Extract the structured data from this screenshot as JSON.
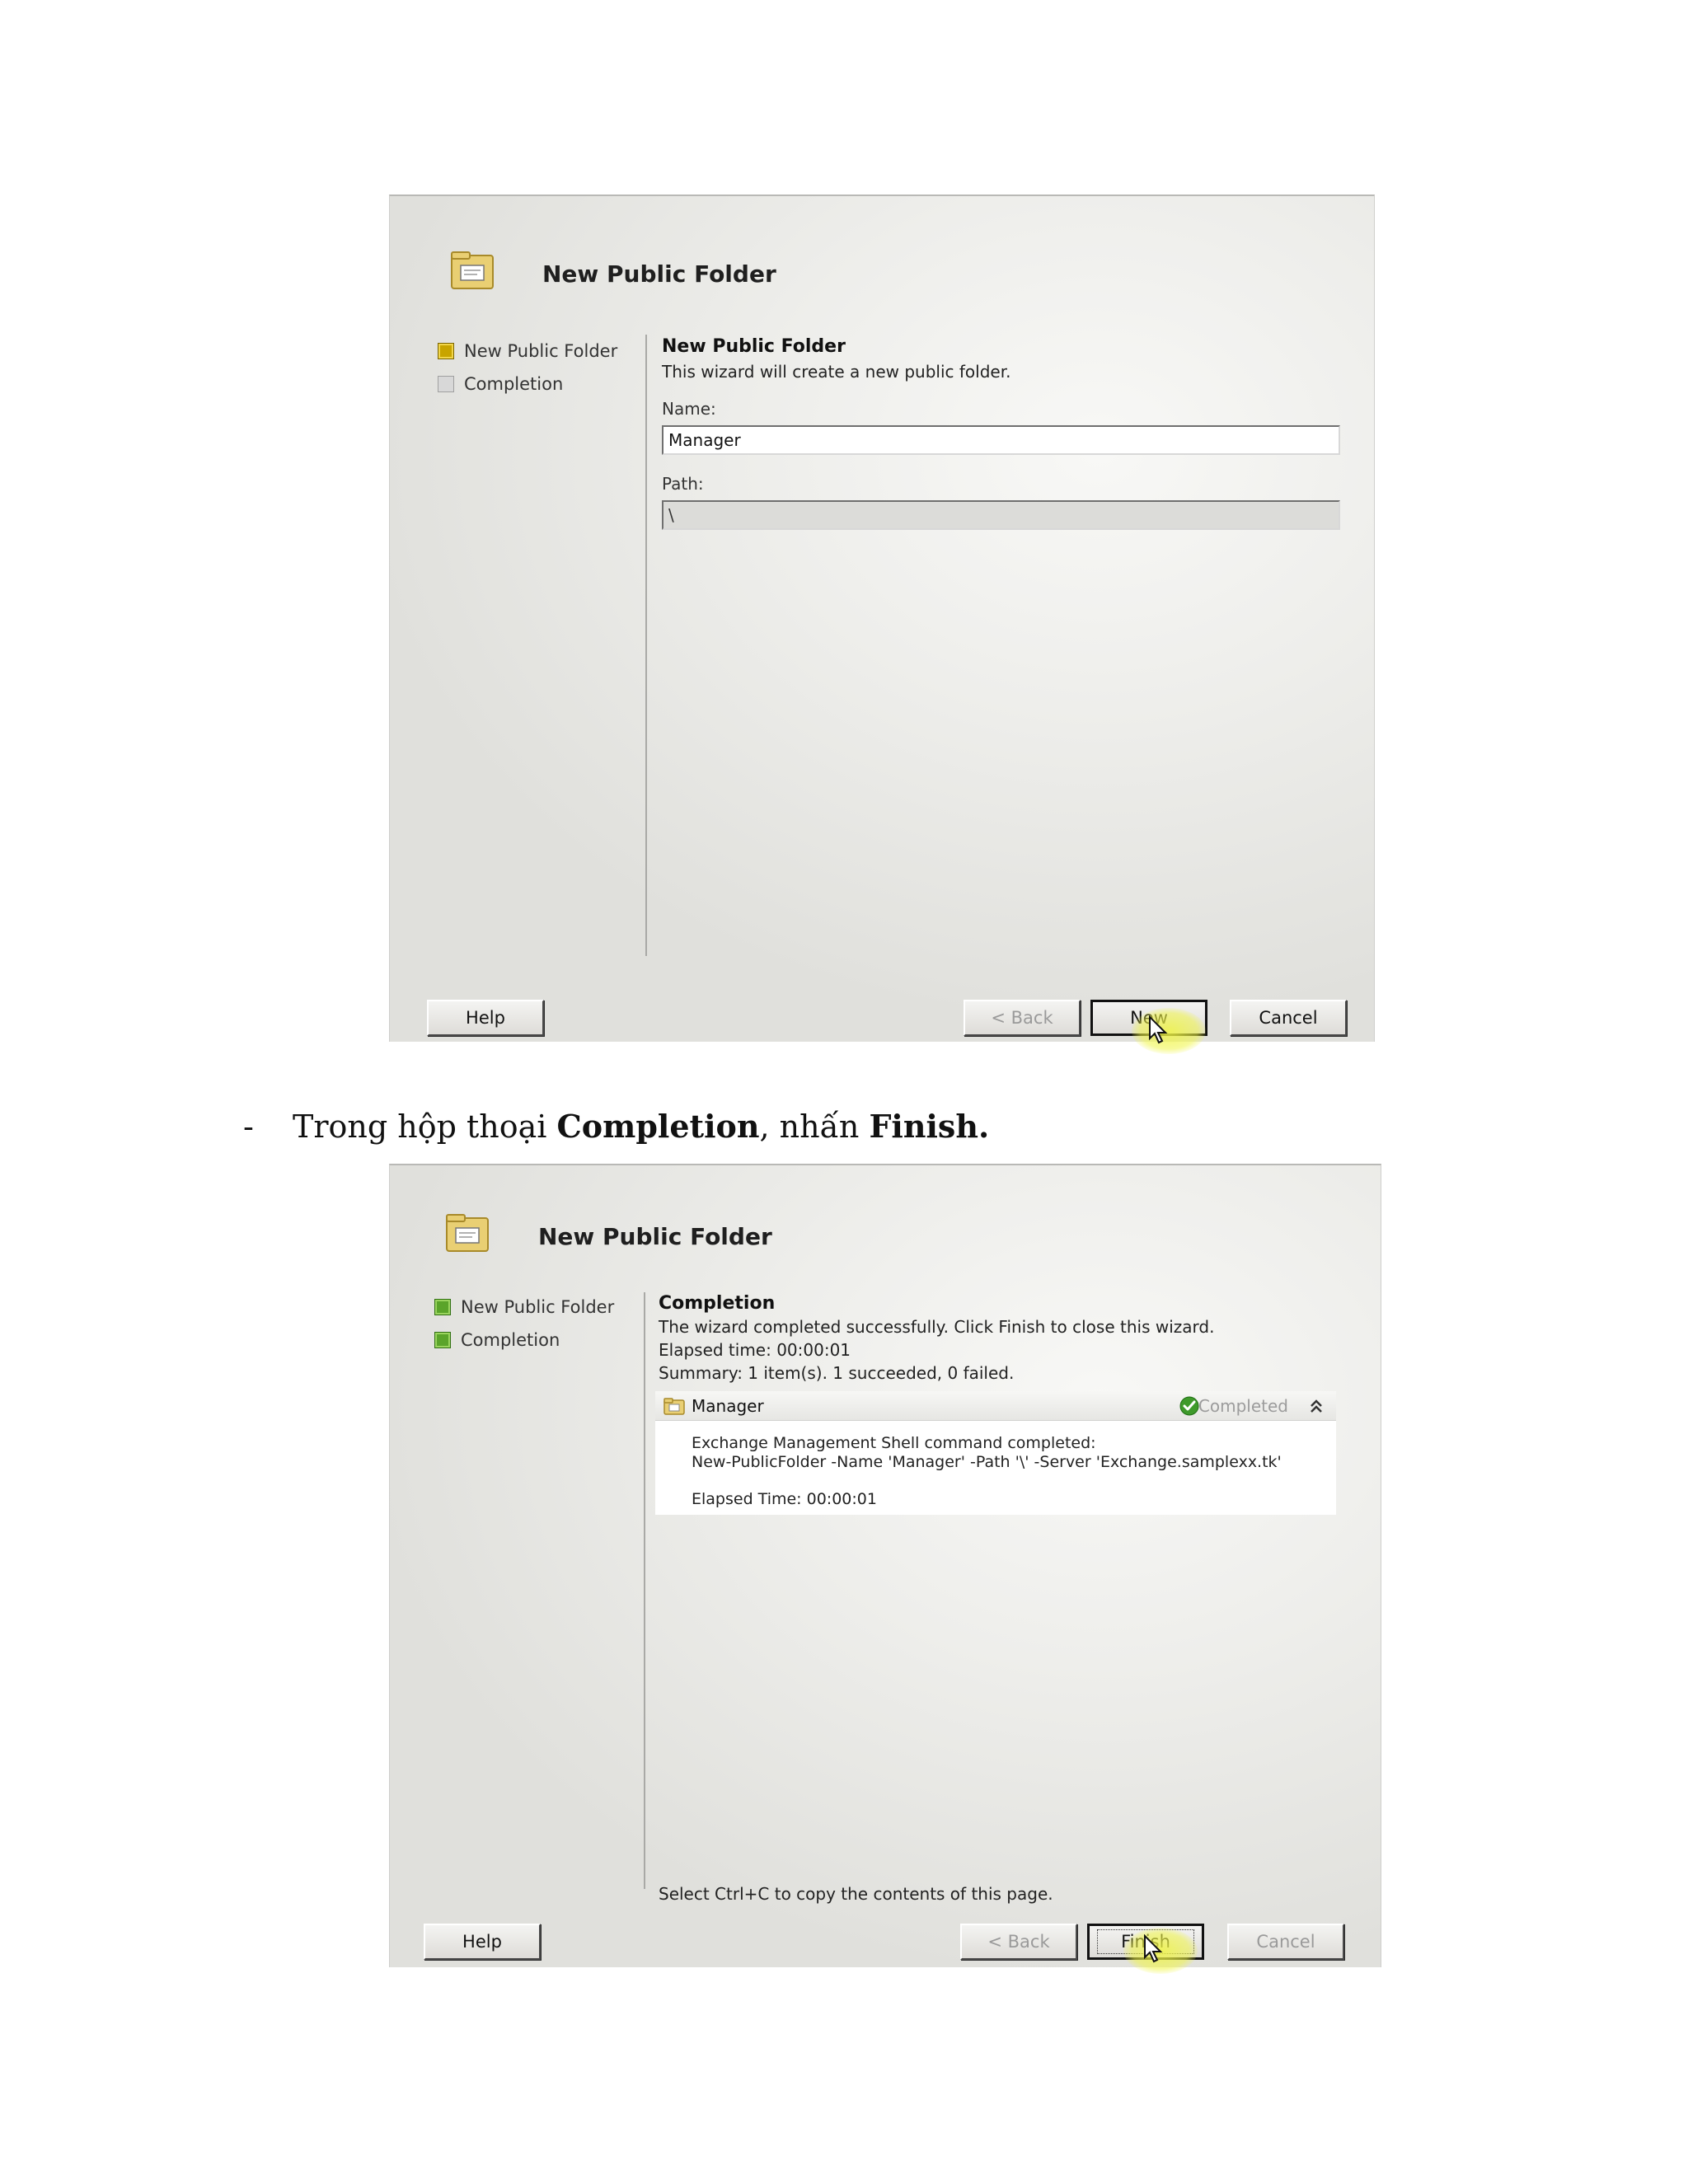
{
  "wizard1": {
    "title": "New Public Folder",
    "steps": [
      {
        "label": "New Public Folder"
      },
      {
        "label": "Completion"
      }
    ],
    "section_title": "New Public Folder",
    "description": "This wizard will create a new public folder.",
    "name_label": "Name:",
    "name_value": "Manager",
    "path_label": "Path:",
    "path_value": "\\",
    "buttons": {
      "help": "Help",
      "back": "< Back",
      "new": "New",
      "cancel": "Cancel"
    }
  },
  "instruction": {
    "dash": "-",
    "prefix": "Trong hộp thoại ",
    "bold1": "Completion",
    "middle": ", nhấn ",
    "bold2": "Finish."
  },
  "wizard2": {
    "title": "New Public Folder",
    "steps": [
      {
        "label": "New Public Folder"
      },
      {
        "label": "Completion"
      }
    ],
    "section_title": "Completion",
    "line1": "The wizard completed successfully. Click Finish to close this wizard.",
    "elapsed": "Elapsed time: 00:00:01",
    "summary": "Summary: 1 item(s). 1 succeeded, 0 failed.",
    "item": {
      "name": "Manager",
      "status": "Completed",
      "line1": "Exchange Management Shell command completed:",
      "line2": "New-PublicFolder -Name 'Manager' -Path '\\' -Server 'Exchange.samplexx.tk'",
      "elapsed": "Elapsed Time: 00:00:01"
    },
    "footer_hint": "Select Ctrl+C to copy the contents of this page.",
    "buttons": {
      "help": "Help",
      "back": "< Back",
      "finish": "Finish",
      "cancel": "Cancel"
    }
  }
}
